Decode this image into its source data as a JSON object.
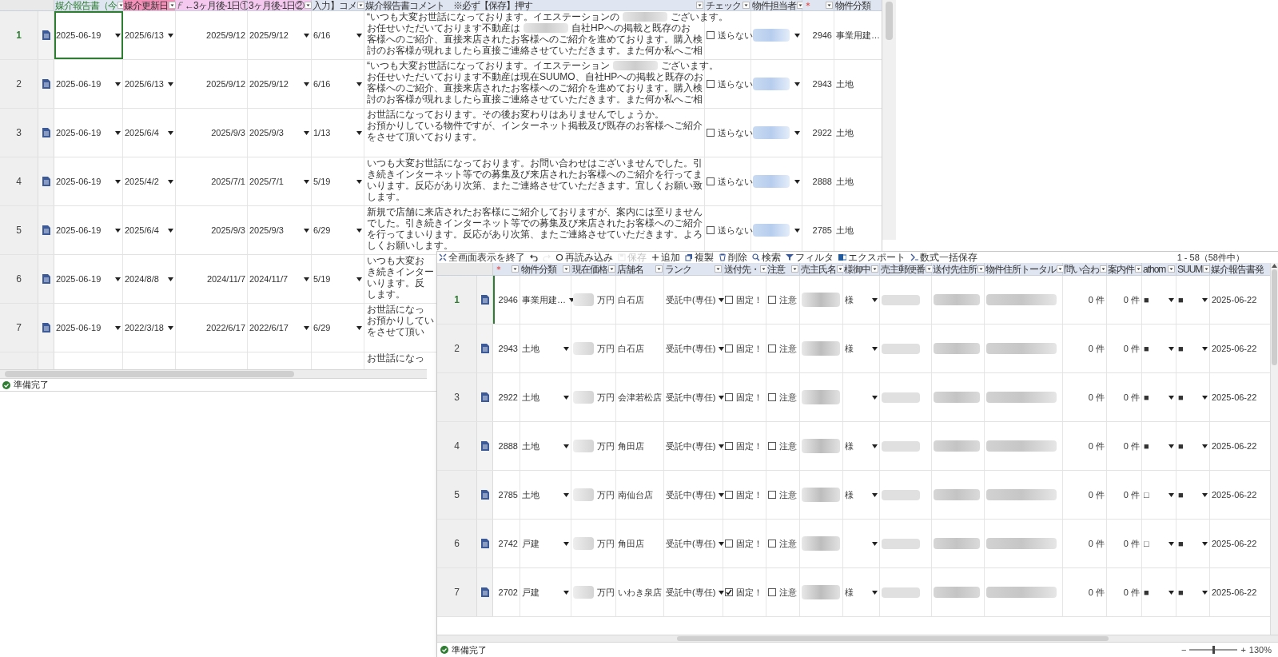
{
  "sheet": {
    "columns": [
      {
        "label": "媒介報告書（今",
        "kind": "green",
        "filter": true
      },
      {
        "label": "媒介更新日",
        "kind": "pink",
        "filter": true
      },
      {
        "label": "←3ヶ月後-1日①",
        "kind": "lavender",
        "filter": false,
        "formula": true
      },
      {
        "label": "3ヶ月後-1日②",
        "kind": "lavender",
        "filter": true
      },
      {
        "label": "入力】コメ",
        "kind": "blue",
        "filter": true
      },
      {
        "label": "媒介報告書コメント　※必ず【保存】押す",
        "kind": "blue",
        "filter": true
      },
      {
        "label": "チェック",
        "kind": "plain",
        "filter": true
      },
      {
        "label": "物件担当者",
        "kind": "plain",
        "filter": true
      },
      {
        "label": "＊",
        "kind": "required",
        "filter": true
      },
      {
        "label": "物件分類",
        "kind": "plain",
        "filter": false
      }
    ],
    "rows": [
      {
        "num": "1",
        "selected": true,
        "document": true,
        "report_date": "2025-06-19",
        "renewal_date": "2025/6/13",
        "date1": "2025/9/12",
        "date2": "2025/9/12",
        "input": "6/16",
        "comment": [
          [
            "“いつも大変お世話になっております。イエステーションの",
            {
              "kind": "blur"
            },
            "ございます。"
          ],
          [
            "お任せいただいております不動産は",
            {
              "kind": "blur"
            },
            "自社HPへの掲載と既存のお"
          ],
          [
            "客様へのご紹介、直接来店されたお客様へのご紹介を進めております。購入検"
          ],
          [
            "討のお客様が現れましたら直接ご連絡させていただきます。また何か私へご相"
          ]
        ],
        "check": {
          "label": "送らない",
          "checked": false
        },
        "agent_blurred": true,
        "number": "2946",
        "category": "事業用建…"
      },
      {
        "num": "2",
        "selected": false,
        "document": true,
        "report_date": "2025-06-19",
        "renewal_date": "2025/6/13",
        "date1": "2025/9/12",
        "date2": "2025/9/12",
        "input": "6/16",
        "comment": [
          [
            "“いつも大変お世話になっております。イエステーション",
            {
              "kind": "blur"
            },
            "ございます。"
          ],
          [
            "お任せいただいております不動産は現在SUUMO、自社HPへの掲載と既存のお"
          ],
          [
            "客様へのご紹介、直接来店されたお客様へのご紹介を進めております。購入検"
          ],
          [
            "討のお客様が現れましたら直接ご連絡させていただきます。また何か私へご相"
          ]
        ],
        "check": {
          "label": "送らない",
          "checked": false
        },
        "agent_blurred": true,
        "number": "2943",
        "category": "土地"
      },
      {
        "num": "3",
        "selected": false,
        "document": true,
        "report_date": "2025-06-19",
        "renewal_date": "2025/6/4",
        "date1": "2025/9/3",
        "date2": "2025/9/3",
        "input": "1/13",
        "comment": [
          [
            "お世話になっております。その後お変わりはありませんでしょうか。"
          ],
          [
            "お預かりしている物件ですが、インターネット掲載及び既存のお客様へご紹介"
          ],
          [
            "をさせて頂いております。"
          ]
        ],
        "check": {
          "label": "送らない",
          "checked": false
        },
        "agent_blurred": true,
        "number": "2922",
        "category": "土地"
      },
      {
        "num": "4",
        "selected": false,
        "document": true,
        "report_date": "2025-06-19",
        "renewal_date": "2025/4/2",
        "date1": "2025/7/1",
        "date2": "2025/7/1",
        "input": "5/19",
        "comment": [
          [
            "いつも大変お世話になっております。お問い合わせはございませんでした。引"
          ],
          [
            "き続きインターネット等での募集及び来店されたお客様へのご紹介を行ってま"
          ],
          [
            "いります。反応があり次第、またご連絡させていただきます。宜しくお願い致"
          ],
          [
            "します。"
          ]
        ],
        "check": {
          "label": "送らない",
          "checked": false
        },
        "agent_blurred": true,
        "number": "2888",
        "category": "土地"
      },
      {
        "num": "5",
        "selected": false,
        "document": true,
        "report_date": "2025-06-19",
        "renewal_date": "2025/6/4",
        "date1": "2025/9/3",
        "date2": "2025/9/3",
        "input": "6/29",
        "comment": [
          [
            "新規で店舗に来店されたお客様にご紹介しておりますが、案内には至りません"
          ],
          [
            "でした。引き続きインターネット等での募集及び来店されたお客様へのご紹介"
          ],
          [
            "を行ってまいります。反応があり次第、またご連絡させていただきます。よろ"
          ],
          [
            "しくお願いします。"
          ]
        ],
        "check": {
          "label": "送らない",
          "checked": false
        },
        "agent_blurred": true,
        "number": "2785",
        "category": "土地"
      },
      {
        "num": "6",
        "selected": false,
        "document": true,
        "report_date": "2025-06-19",
        "renewal_date": "2024/8/8",
        "date1": "2024/11/7",
        "date2": "2024/11/7",
        "input": "5/19",
        "comment": [
          [
            "いつも大変お"
          ],
          [
            "き続きインター"
          ],
          [
            "いります。反"
          ],
          [
            "します。"
          ]
        ]
      },
      {
        "num": "7",
        "selected": false,
        "document": true,
        "report_date": "2025-06-19",
        "renewal_date": "2022/3/18",
        "date1": "2022/6/17",
        "date2": "2022/6/17",
        "input": "6/29",
        "comment": [
          [
            "お世話になっ"
          ],
          [
            "お預かりしてい"
          ],
          [
            "をさせて頂い"
          ]
        ]
      },
      {
        "selected": false,
        "comment": [
          [
            "お世話になっ"
          ]
        ]
      }
    ],
    "status": "準備完了"
  },
  "table_window": {
    "toolbar": [
      {
        "label": "全画面表示を終了",
        "disabled": false
      },
      {
        "disabled": false
      },
      {
        "disabled": true
      },
      {
        "label": "再読み込み",
        "disabled": false
      },
      {
        "label": "保存",
        "disabled": true
      },
      {
        "label": "追加",
        "disabled": false
      },
      {
        "label": "複製",
        "disabled": false
      },
      {
        "label": "削除",
        "disabled": false
      },
      {
        "label": "検索",
        "disabled": false
      },
      {
        "label": "フィルタ",
        "disabled": false
      },
      {
        "label": "エクスポート",
        "disabled": false
      },
      {
        "label": "数式一括保存",
        "disabled": false
      }
    ],
    "record_count": "1 - 58（58件中）",
    "columns": [
      {
        "label": "＊",
        "kind": "required",
        "filter": true
      },
      {
        "label": "物件分類",
        "kind": "plain",
        "filter": true
      },
      {
        "label": "現在価格",
        "kind": "plain",
        "filter": true
      },
      {
        "label": "店舗名",
        "kind": "plain",
        "filter": true
      },
      {
        "label": "ランク",
        "kind": "plain",
        "filter": true
      },
      {
        "label": "送付先・",
        "kind": "plain",
        "filter": true
      },
      {
        "label": "注意",
        "kind": "plain",
        "filter": true
      },
      {
        "label": "売主氏名",
        "kind": "plain",
        "filter": true
      },
      {
        "label": "様御中",
        "kind": "plain",
        "filter": true
      },
      {
        "label": "売主郵便番",
        "kind": "plain",
        "filter": true
      },
      {
        "label": "送付先住所",
        "kind": "plain",
        "filter": true
      },
      {
        "label": "物件住所トータル",
        "kind": "plain",
        "filter": true
      },
      {
        "label": "問い合わ",
        "kind": "plain",
        "filter": true
      },
      {
        "label": "案内件",
        "kind": "plain",
        "filter": true
      },
      {
        "label": "athom",
        "kind": "plain",
        "filter": true
      },
      {
        "label": "SUUM",
        "kind": "plain",
        "filter": true
      },
      {
        "label": "媒介報告書発",
        "kind": "plain",
        "filter": false
      }
    ],
    "rows": [
      {
        "num": "1",
        "selected": true,
        "number": "2946",
        "category": "事業用建…",
        "unit": "万円",
        "store": "白石店",
        "rank": "受託中(専任)",
        "send": {
          "label": "固定！",
          "checked": false
        },
        "caution": {
          "label": "注意",
          "checked": false
        },
        "honorific": "様",
        "inquiries": "0 件",
        "visits": "0 件",
        "athome": "■",
        "suumo": "■",
        "report_sent": "2025-06-22"
      },
      {
        "num": "2",
        "selected": false,
        "number": "2943",
        "category": "土地",
        "unit": "万円",
        "store": "白石店",
        "rank": "受託中(専任)",
        "send": {
          "label": "固定！",
          "checked": false
        },
        "caution": {
          "label": "注意",
          "checked": false
        },
        "honorific": "様",
        "inquiries": "0 件",
        "visits": "0 件",
        "athome": "■",
        "suumo": "■",
        "report_sent": "2025-06-22"
      },
      {
        "num": "3",
        "selected": false,
        "number": "2922",
        "category": "土地",
        "unit": "万円",
        "store": "会津若松店",
        "rank": "受託中(専任)",
        "send": {
          "label": "固定！",
          "checked": false
        },
        "caution": {
          "label": "注意",
          "checked": false
        },
        "inquiries": "0 件",
        "visits": "0 件",
        "athome": "■",
        "suumo": "■",
        "report_sent": "2025-06-22"
      },
      {
        "num": "4",
        "selected": false,
        "number": "2888",
        "category": "土地",
        "unit": "万円",
        "store": "角田店",
        "rank": "受託中(専任)",
        "send": {
          "label": "固定！",
          "checked": false
        },
        "caution": {
          "label": "注意",
          "checked": false
        },
        "honorific": "様",
        "inquiries": "0 件",
        "visits": "0 件",
        "athome": "■",
        "suumo": "■",
        "report_sent": "2025-06-22"
      },
      {
        "num": "5",
        "selected": false,
        "number": "2785",
        "category": "土地",
        "unit": "万円",
        "store": "南仙台店",
        "rank": "受託中(専任)",
        "send": {
          "label": "固定！",
          "checked": false
        },
        "caution": {
          "label": "注意",
          "checked": false
        },
        "honorific": "様",
        "inquiries": "0 件",
        "visits": "0 件",
        "athome": "□",
        "suumo": "■",
        "report_sent": "2025-06-22"
      },
      {
        "num": "6",
        "selected": false,
        "number": "2742",
        "category": "戸建",
        "unit": "万円",
        "store": "角田店",
        "rank": "受託中(専任)",
        "send": {
          "label": "固定！",
          "checked": false
        },
        "caution": {
          "label": "注意",
          "checked": false
        },
        "inquiries": "0 件",
        "visits": "0 件",
        "athome": "□",
        "suumo": "■",
        "report_sent": "2025-06-22"
      },
      {
        "num": "7",
        "selected": false,
        "number": "2702",
        "category": "戸建",
        "unit": "万円",
        "store": "いわき泉店",
        "rank": "受託中(専任)",
        "send": {
          "label": "固定！",
          "checked": true
        },
        "caution": {
          "label": "注意",
          "checked": false
        },
        "honorific": "様",
        "inquiries": "0 件",
        "visits": "0 件",
        "athome": "■",
        "suumo": "■",
        "report_sent": "2025-06-22"
      }
    ],
    "status": "準備完了",
    "zoom": {
      "minus": "−",
      "plus": "+",
      "level": 0.5,
      "label": "130%"
    }
  }
}
